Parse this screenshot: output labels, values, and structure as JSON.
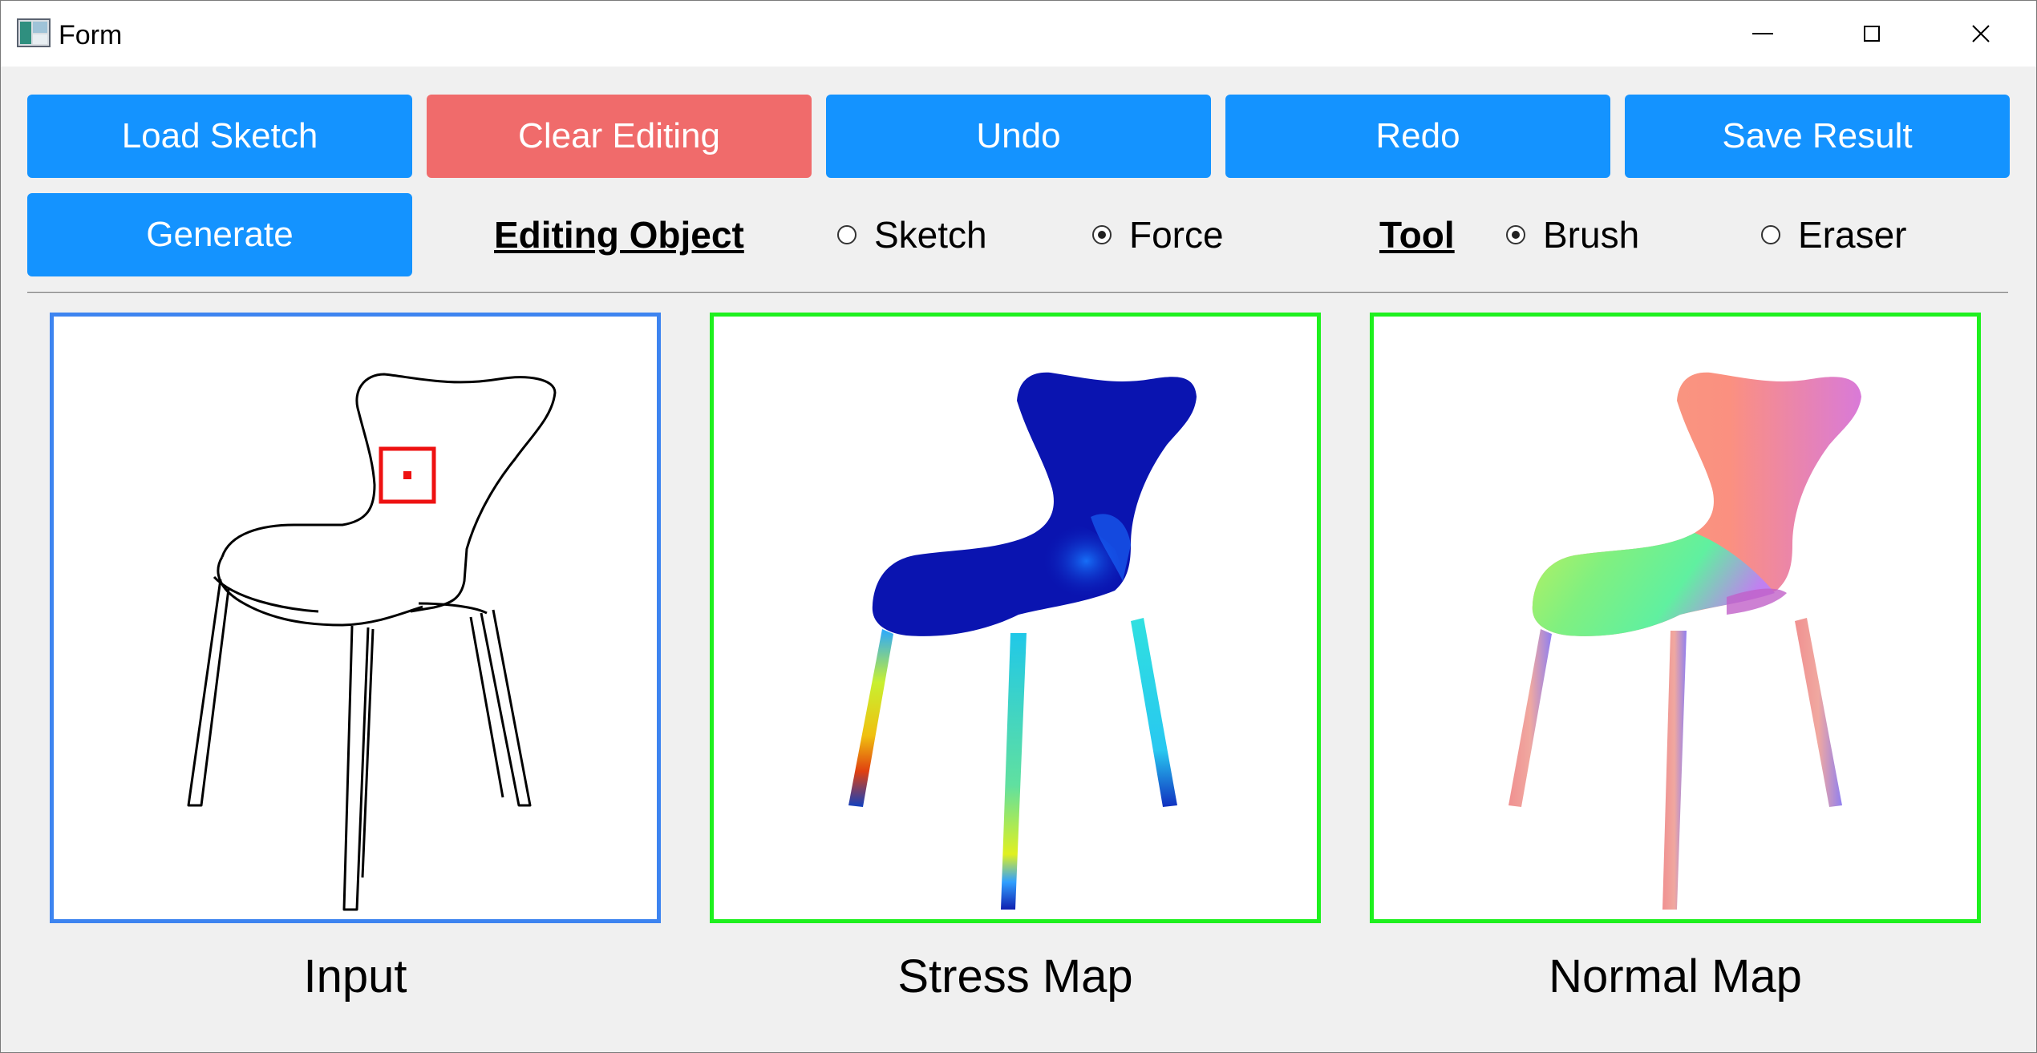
{
  "window": {
    "title": "Form",
    "controls": [
      "minimize-icon",
      "maximize-icon",
      "close-icon"
    ]
  },
  "toolbar": {
    "load_sketch": "Load Sketch",
    "clear_editing": "Clear Editing",
    "undo": "Undo",
    "redo": "Redo",
    "save_result": "Save Result",
    "generate": "Generate"
  },
  "options": {
    "editing_object_label": "Editing Object",
    "editing_object_choices": [
      {
        "label": "Sketch",
        "checked": false
      },
      {
        "label": "Force",
        "checked": true
      }
    ],
    "tool_label": "Tool",
    "tool_choices": [
      {
        "label": "Brush",
        "checked": true
      },
      {
        "label": "Eraser",
        "checked": false
      }
    ]
  },
  "panels": {
    "input_caption": "Input",
    "stress_caption": "Stress Map",
    "normal_caption": "Normal Map"
  },
  "colors": {
    "button_blue": "#1493ff",
    "button_red": "#f06b6b",
    "input_border": "#3d84f0",
    "output_border": "#1ef01e",
    "selection_marker": "#ee1111"
  }
}
